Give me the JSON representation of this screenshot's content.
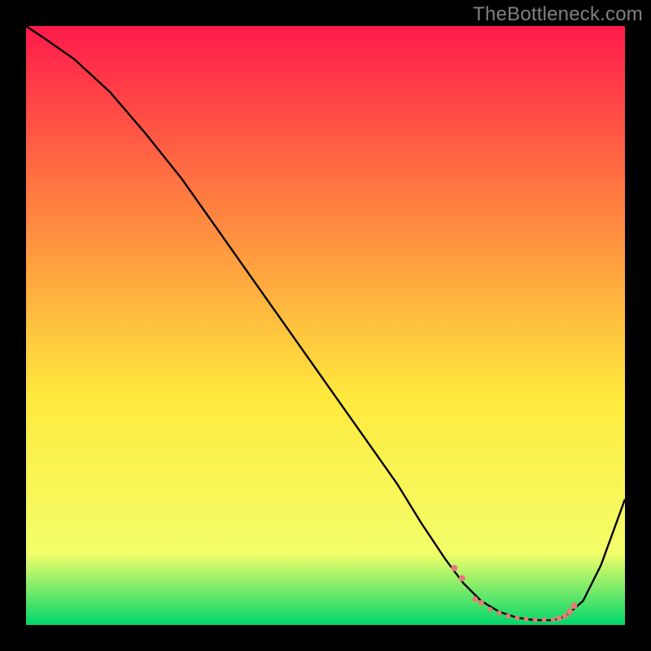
{
  "watermark": "TheBottleneck.com",
  "chart_data": {
    "type": "line",
    "title": "",
    "xlabel": "",
    "ylabel": "",
    "xlim": [
      0,
      100
    ],
    "ylim": [
      0,
      100
    ],
    "gradient_colors": {
      "top": "#ff1a4b",
      "mid_upper": "#ff8040",
      "mid": "#ffe93e",
      "mid_lower": "#f3ff6a",
      "bottom": "#00d76a"
    },
    "curve": {
      "name": "bottleneck-curve",
      "color": "#000000",
      "x": [
        0,
        3,
        8,
        14,
        20,
        26,
        32,
        38,
        44,
        50,
        56,
        62,
        66,
        70,
        73,
        76,
        79,
        82,
        85,
        88,
        90,
        93,
        96,
        100
      ],
      "y": [
        100,
        98,
        94.5,
        89,
        82,
        74.5,
        66,
        57.5,
        49,
        40.5,
        32,
        23.5,
        17,
        11,
        7,
        4,
        2.2,
        1.2,
        0.8,
        0.8,
        1.4,
        4,
        10,
        21
      ]
    },
    "markers": {
      "name": "optimal-zone-markers",
      "color": "#e87b77",
      "x": [
        71.5,
        72.8,
        75.0,
        76.0,
        77.5,
        79.0,
        80.5,
        82.0,
        83.5,
        85.0,
        86.5,
        88.0,
        89.0,
        90.0,
        90.8,
        91.5
      ],
      "y": [
        9.5,
        7.8,
        4.3,
        3.7,
        2.6,
        2.0,
        1.5,
        1.2,
        1.0,
        0.85,
        0.85,
        0.9,
        1.1,
        1.5,
        2.2,
        3.2
      ],
      "sizes": [
        8,
        8,
        7,
        7,
        6,
        6,
        6,
        6,
        6,
        6,
        6,
        6,
        7,
        7,
        8,
        8
      ]
    }
  }
}
